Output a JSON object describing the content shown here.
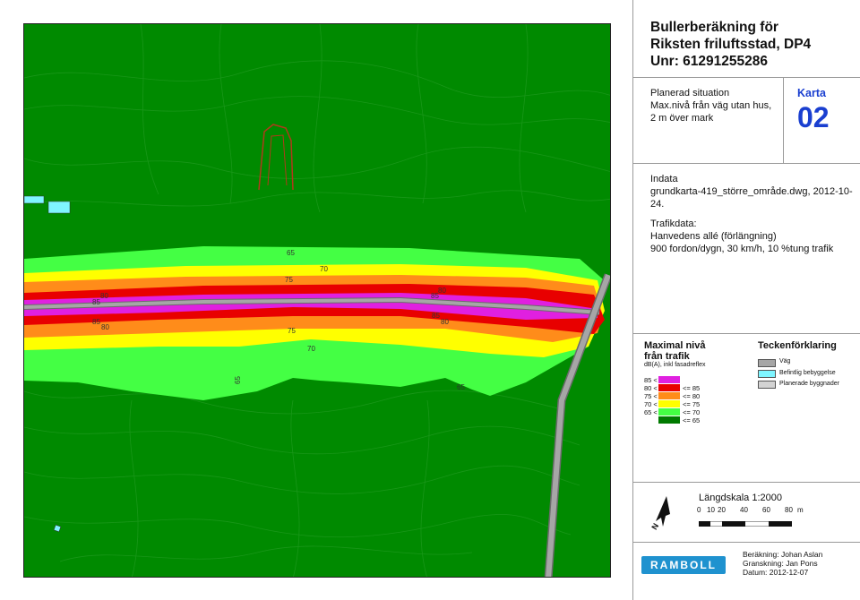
{
  "title": {
    "line1": "Bullerberäkning för",
    "line2": "Riksten friluftsstad, DP4",
    "line3": "Unr: 61291255286"
  },
  "situation": {
    "line1": "Planerad situation",
    "line2": "Max.nivå från väg utan hus,",
    "line3": "2 m över mark"
  },
  "karta": {
    "label": "Karta",
    "number": "02"
  },
  "indata": {
    "label": "Indata",
    "file": "grundkarta-419_större_område.dwg, 2012-10-24."
  },
  "trafikdata": {
    "label": "Trafikdata:",
    "road": "Hanvedens allé (förlängning)",
    "details": "900 fordon/dygn, 30 km/h, 10 %tung trafik"
  },
  "legend": {
    "title1": "Maximal nivå",
    "title2": "från trafik",
    "unit": "dB(A), inkl fasadreflex",
    "rows": [
      {
        "low": "85 <",
        "high": "",
        "color": "#e020e0"
      },
      {
        "low": "80 <",
        "high": "<= 85",
        "color": "#e80000"
      },
      {
        "low": "75 <",
        "high": "<= 80",
        "color": "#ff8c1a"
      },
      {
        "low": "70 <",
        "high": "<= 75",
        "color": "#ffff00"
      },
      {
        "low": "65 <",
        "high": "<= 70",
        "color": "#44ff44"
      },
      {
        "low": "",
        "high": "<= 65",
        "color": "#007a00"
      }
    ]
  },
  "teckenforklaring": {
    "title": "Teckenförklaring",
    "items": [
      {
        "label": "Väg",
        "color": "#a6a6a6"
      },
      {
        "label": "Befintlig bebyggelse",
        "color": "#7ff5ff"
      },
      {
        "label": "Planerade byggnader",
        "color": "#d3d3d3"
      }
    ]
  },
  "scale": {
    "title": "Längdskala 1:2000",
    "ticks": [
      "0",
      "10",
      "20",
      "40",
      "60",
      "80"
    ],
    "unit": "m"
  },
  "credits": {
    "line1": "Beräkning: Johan Aslan",
    "line2": "Granskning: Jan Pons",
    "line3": "Datum: 2012-12-07"
  },
  "logo": "RAMBOLL",
  "map_labels": {
    "l65top": "65",
    "l70top": "70",
    "l75top": "75",
    "l80a": "80",
    "l85a": "85",
    "l80b": "80",
    "l85b": "85",
    "l85c": "85",
    "l80c": "80",
    "l85d": "85",
    "l80d": "80",
    "l75bot": "75",
    "l70bot": "70",
    "l65left": "65",
    "l65right": "65"
  },
  "colors": {
    "background_green": "#008a00",
    "band_65_70": "#44ff44",
    "band_70_75": "#ffff00",
    "band_75_80": "#ff8c1a",
    "band_80_85": "#e80000",
    "band_85": "#e020e0",
    "road": "#a6a6a6",
    "existing_building": "#7ff5ff",
    "accent_blue": "#1a3fd0"
  }
}
